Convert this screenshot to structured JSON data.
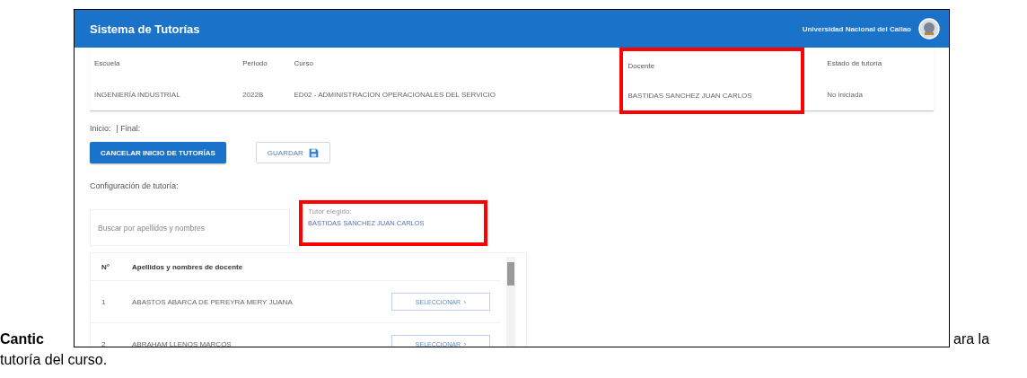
{
  "document": {
    "text_before": "Cantic",
    "text_after": "ara la",
    "text_line_2": "tutoría del curso."
  },
  "app": {
    "title": "Sistema de Tutorías",
    "institution": "Universidad Nacional del Callao",
    "info": [
      {
        "header": "Escuela",
        "value": "INGENIERÍA INDUSTRIAL",
        "highlighted": false
      },
      {
        "header": "Periodo",
        "value": "2022B",
        "highlighted": false
      },
      {
        "header": "Curso",
        "value": "ED02 - ADMINISTRACION OPERACIONALES DEL SERVICIO",
        "highlighted": false
      },
      {
        "header": "Docente",
        "value": "BASTIDAS SANCHEZ JUAN CARLOS",
        "highlighted": true
      },
      {
        "header": "Estado de tutoría",
        "value": "No iniciada",
        "highlighted": false
      }
    ],
    "start_label": "Inicio:",
    "end_label": "| Final:",
    "buttons": [
      {
        "kind": "primary",
        "label": "CANCELAR INICIO DE TUTORÍAS"
      },
      {
        "kind": "save",
        "label": "GUARDAR"
      }
    ],
    "section_label": "Configuración de tutoría:",
    "search": {
      "placeholder": "Buscar por apellidos y nombres"
    },
    "tutor": {
      "label": "Tutor elegido:",
      "value": "BASTIDAS SANCHEZ JUAN CARLOS",
      "highlighted": true
    },
    "table": {
      "columns": [
        "N°",
        "Apellidos y nombres de docente"
      ],
      "rows": [
        {
          "number": "1",
          "name": "ABASTOS ABARCA DE PEREYRA MERY JUANA",
          "action": "SELECCIONAR  ›"
        },
        {
          "number": "2",
          "name": "ABRAHAM LLENOS MARCOS",
          "action": "SELECCIONAR  ›"
        }
      ]
    }
  }
}
